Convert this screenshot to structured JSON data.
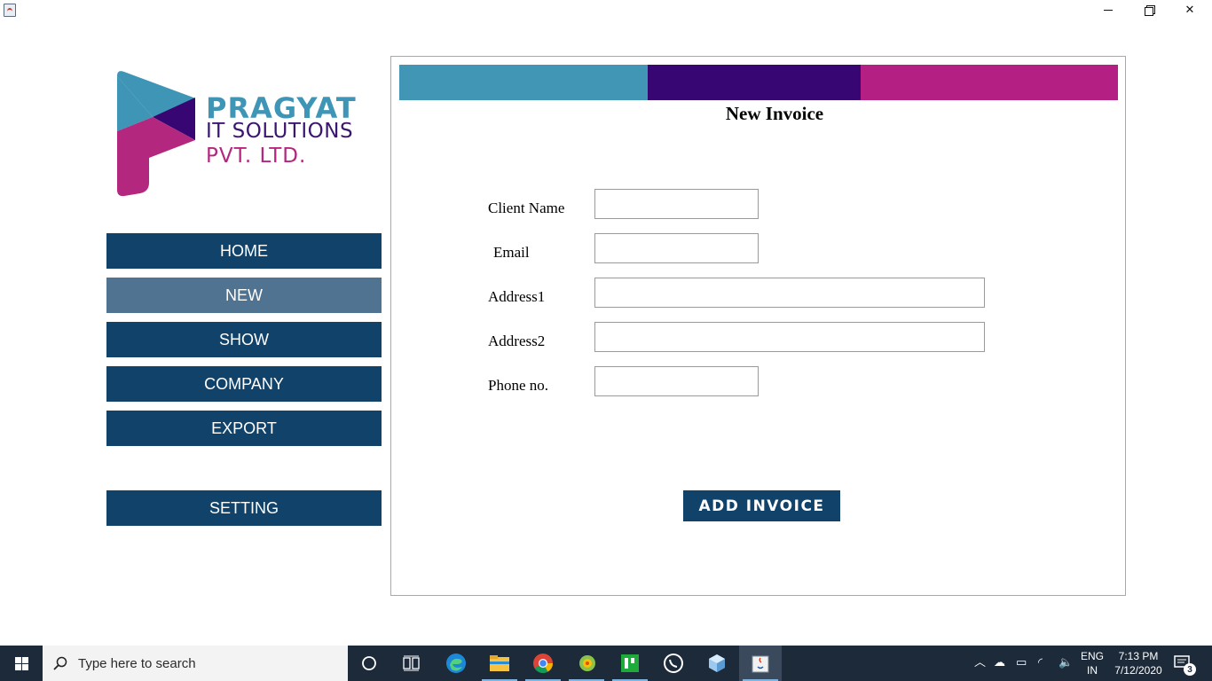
{
  "window": {
    "minimize_glyph": "—",
    "close_glyph": "✕"
  },
  "logo": {
    "line1": "PRAGYAT",
    "line2": "IT SOLUTIONS",
    "line3": "PVT. LTD.",
    "colors": {
      "blue": "#3f95b5",
      "purple": "#3b1670",
      "magenta": "#b3277f"
    }
  },
  "sidebar": {
    "items": [
      {
        "label": "HOME",
        "active": false
      },
      {
        "label": "NEW",
        "active": true
      },
      {
        "label": "SHOW",
        "active": false
      },
      {
        "label": "COMPANY",
        "active": false
      },
      {
        "label": "EXPORT",
        "active": false
      }
    ],
    "setting_label": "SETTING",
    "colors": {
      "button": "#114269",
      "active": "#4f7391",
      "text": "#ffffff"
    }
  },
  "form": {
    "title": "New Invoice",
    "accent_bars": [
      "#4196b5",
      "#380672",
      "#b31f82"
    ],
    "fields": {
      "client_name": {
        "label": "Client Name",
        "value": ""
      },
      "email": {
        "label": "Email",
        "value": ""
      },
      "address1": {
        "label": "Address1",
        "value": ""
      },
      "address2": {
        "label": "Address2",
        "value": ""
      },
      "phone": {
        "label": "Phone no.",
        "value": ""
      }
    },
    "submit_label": "ADD INVOICE"
  },
  "taskbar": {
    "search_placeholder": "Type here to search",
    "apps": [
      "cortana-icon",
      "task-view-icon",
      "edge-icon",
      "file-explorer-icon",
      "chrome-icon",
      "app-icon",
      "app-icon",
      "whatsapp-icon",
      "app-icon",
      "java-icon"
    ],
    "tray": {
      "language_line1": "ENG",
      "language_line2": "IN",
      "time": "7:13 PM",
      "date": "7/12/2020",
      "notification_count": "3"
    }
  }
}
